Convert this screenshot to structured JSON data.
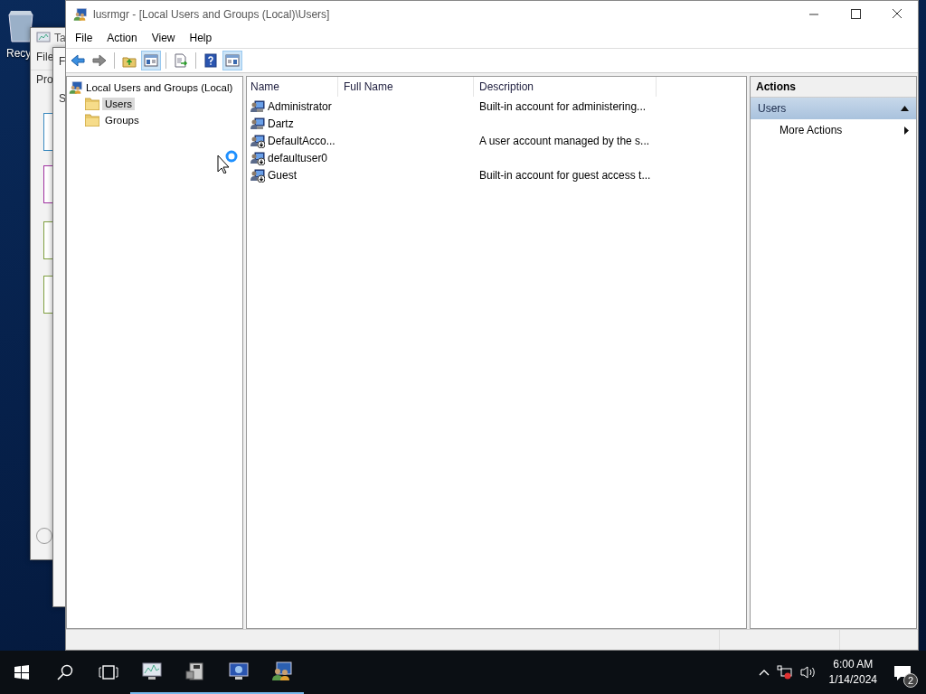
{
  "desktop": {
    "icons": [
      {
        "label": "Recy"
      }
    ]
  },
  "background_windows": [
    {
      "title": "Ta",
      "menu": [
        "File"
      ],
      "tab": "Pro"
    },
    {
      "menu": [
        "F"
      ],
      "label": "S"
    }
  ],
  "window": {
    "title": "lusrmgr - [Local Users and Groups (Local)\\Users]",
    "menu": [
      "File",
      "Action",
      "View",
      "Help"
    ],
    "toolbar": [
      {
        "kind": "back",
        "pressed": false
      },
      {
        "kind": "forward",
        "pressed": false
      },
      {
        "kind": "sep"
      },
      {
        "kind": "up",
        "pressed": false
      },
      {
        "kind": "tree",
        "pressed": true
      },
      {
        "kind": "sep"
      },
      {
        "kind": "export",
        "pressed": false
      },
      {
        "kind": "sep"
      },
      {
        "kind": "help",
        "pressed": false
      },
      {
        "kind": "actionpane",
        "pressed": true
      }
    ],
    "tree": {
      "label": "Local Users and Groups (Local)",
      "children": [
        {
          "label": "Users",
          "selected": true
        },
        {
          "label": "Groups",
          "selected": false
        }
      ]
    },
    "list": {
      "columns": [
        "Name",
        "Full Name",
        "Description"
      ],
      "rows": [
        {
          "name": "Administrator",
          "disabled": false,
          "description": "Built-in account for administering..."
        },
        {
          "name": "Dartz",
          "disabled": false
        },
        {
          "name": "DefaultAcco...",
          "disabled": true,
          "description": "A user account managed by the s..."
        },
        {
          "name": "defaultuser0",
          "disabled": true
        },
        {
          "name": "Guest",
          "disabled": true,
          "description": "Built-in account for guest access t..."
        }
      ]
    },
    "actions": {
      "title": "Actions",
      "sections": [
        {
          "label": "Users",
          "expanded": true,
          "items": [
            {
              "label": "More Actions"
            }
          ]
        }
      ]
    }
  },
  "taskbar": {
    "apps": [
      {
        "kind": "monitor",
        "running": true
      },
      {
        "kind": "server",
        "running": true
      },
      {
        "kind": "computer",
        "running": true
      },
      {
        "kind": "users",
        "running": true
      }
    ],
    "clock": {
      "time": "6:00 AM",
      "date": "1/14/2024"
    },
    "notifications": {
      "count": "2"
    }
  }
}
